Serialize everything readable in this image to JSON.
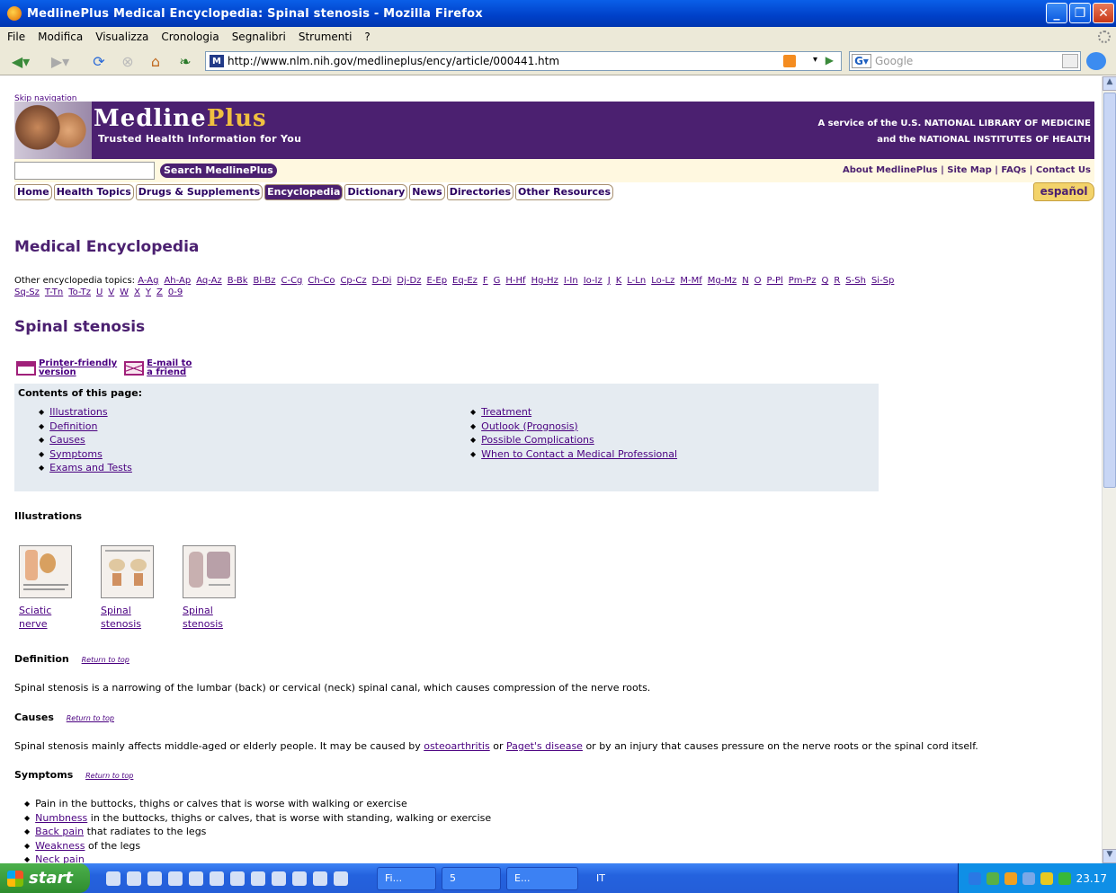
{
  "window": {
    "title": "MedlinePlus Medical Encyclopedia: Spinal stenosis - Mozilla Firefox"
  },
  "menu": [
    "File",
    "Modifica",
    "Visualizza",
    "Cronologia",
    "Segnalibri",
    "Strumenti",
    "?"
  ],
  "navbar": {
    "url": "http://www.nlm.nih.gov/medlineplus/ency/article/000441.htm",
    "search_placeholder": "Google",
    "url_icon": "M"
  },
  "site": {
    "skip": "Skip navigation",
    "logo_medline": "Medline",
    "logo_plus": "Plus",
    "tagline": "Trusted Health Information for You",
    "service_line1": "A service of the U.S. NATIONAL LIBRARY OF MEDICINE",
    "service_line2": "and the NATIONAL INSTITUTES OF HEALTH",
    "search_button": "Search MedlinePlus",
    "top_links": "About MedlinePlus | Site Map | FAQs | Contact Us",
    "tabs": [
      "Home",
      "Health Topics",
      "Drugs & Supplements",
      "Encyclopedia",
      "Dictionary",
      "News",
      "Directories",
      "Other Resources"
    ],
    "espanol": "español"
  },
  "page": {
    "heading": "Medical Encyclopedia",
    "other_label": "Other encyclopedia topics:",
    "letters": [
      "A-Ag",
      "Ah-Ap",
      "Aq-Az",
      "B-Bk",
      "Bl-Bz",
      "C-Cg",
      "Ch-Co",
      "Cp-Cz",
      "D-Di",
      "Dj-Dz",
      "E-Ep",
      "Eq-Ez",
      "F",
      "G",
      "H-Hf",
      "Hg-Hz",
      "I-In",
      "Io-Iz",
      "J",
      "K",
      "L-Ln",
      "Lo-Lz",
      "M-Mf",
      "Mg-Mz",
      "N",
      "O",
      "P-Pl",
      "Pm-Pz",
      "Q",
      "R",
      "S-Sh",
      "Si-Sp",
      "Sq-Sz",
      "T-Tn",
      "To-Tz",
      "U",
      "V",
      "W",
      "X",
      "Y",
      "Z",
      "0-9"
    ],
    "article_title": "Spinal stenosis",
    "printer_1": "Printer-friendly",
    "printer_2": "version",
    "email_1": "E-mail to",
    "email_2": "a friend",
    "contents_title": "Contents of this page:",
    "contents_col1": [
      "Illustrations",
      "Definition",
      "Causes",
      "Symptoms",
      "Exams and Tests"
    ],
    "contents_col2": [
      "Treatment",
      "Outlook (Prognosis)",
      "Possible Complications",
      "When to Contact a Medical Professional"
    ],
    "illustrations_title": "Illustrations",
    "thumbs": [
      {
        "l1": "Sciatic nerve",
        "l2": ""
      },
      {
        "l1": "Spinal",
        "l2": "stenosis"
      },
      {
        "l1": "Spinal",
        "l2": "stenosis"
      }
    ],
    "definition_title": "Definition",
    "return_top": "Return to top",
    "definition_text": "Spinal stenosis is a narrowing of the lumbar (back) or cervical (neck) spinal canal, which causes compression of the nerve roots.",
    "causes_title": "Causes",
    "causes_pre": "Spinal stenosis mainly affects middle-aged or elderly people. It may be caused by ",
    "causes_link1": "osteoarthritis",
    "causes_mid": " or ",
    "causes_link2": "Paget's disease",
    "causes_post": " or by an injury that causes pressure on the nerve roots or the spinal cord itself.",
    "symptoms_title": "Symptoms",
    "symptoms": [
      {
        "link": "",
        "text": "Pain in the buttocks, thighs or calves that is worse with walking or exercise"
      },
      {
        "link": "Numbness",
        "text": " in the buttocks, thighs or calves, that is worse with standing, walking or exercise"
      },
      {
        "link": "Back pain",
        "text": " that radiates to the legs"
      },
      {
        "link": "Weakness",
        "text": " of the legs"
      },
      {
        "link": "Neck pain",
        "text": ""
      }
    ]
  },
  "taskbar": {
    "start": "start",
    "task1": "Fi...",
    "task2": "5",
    "task3": "E...",
    "lang": "IT",
    "clock": "23.17"
  }
}
